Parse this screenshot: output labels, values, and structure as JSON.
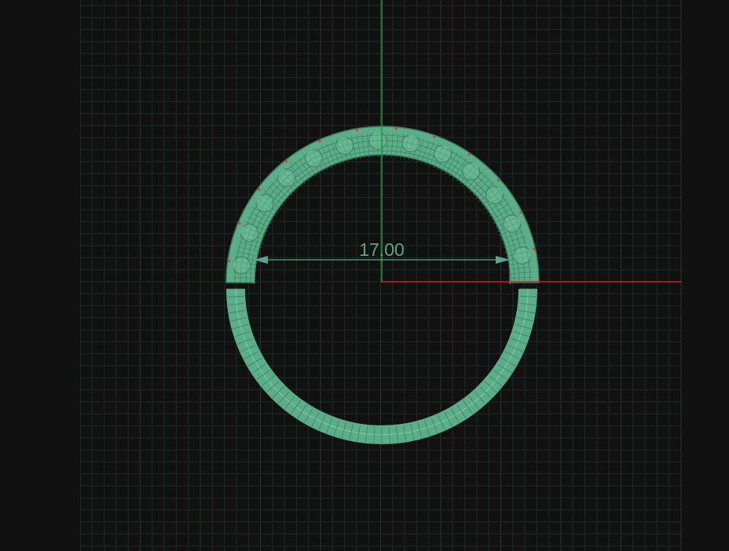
{
  "viewport": {
    "background": "#111111",
    "grid_minor_color": "#1f2a24",
    "grid_major_color": "#2a3530"
  },
  "axes": {
    "y_axis_color": "#1f9a3a",
    "x_axis_color": "#d42020"
  },
  "model": {
    "name": "ring",
    "body_color": "#5cae8a",
    "edge_color": "#3d7f61",
    "highlight_color": "#7fcca6",
    "vertex_marker_color": "#d8402a"
  },
  "dimension": {
    "value": "17.00",
    "color": "#5ca588"
  }
}
